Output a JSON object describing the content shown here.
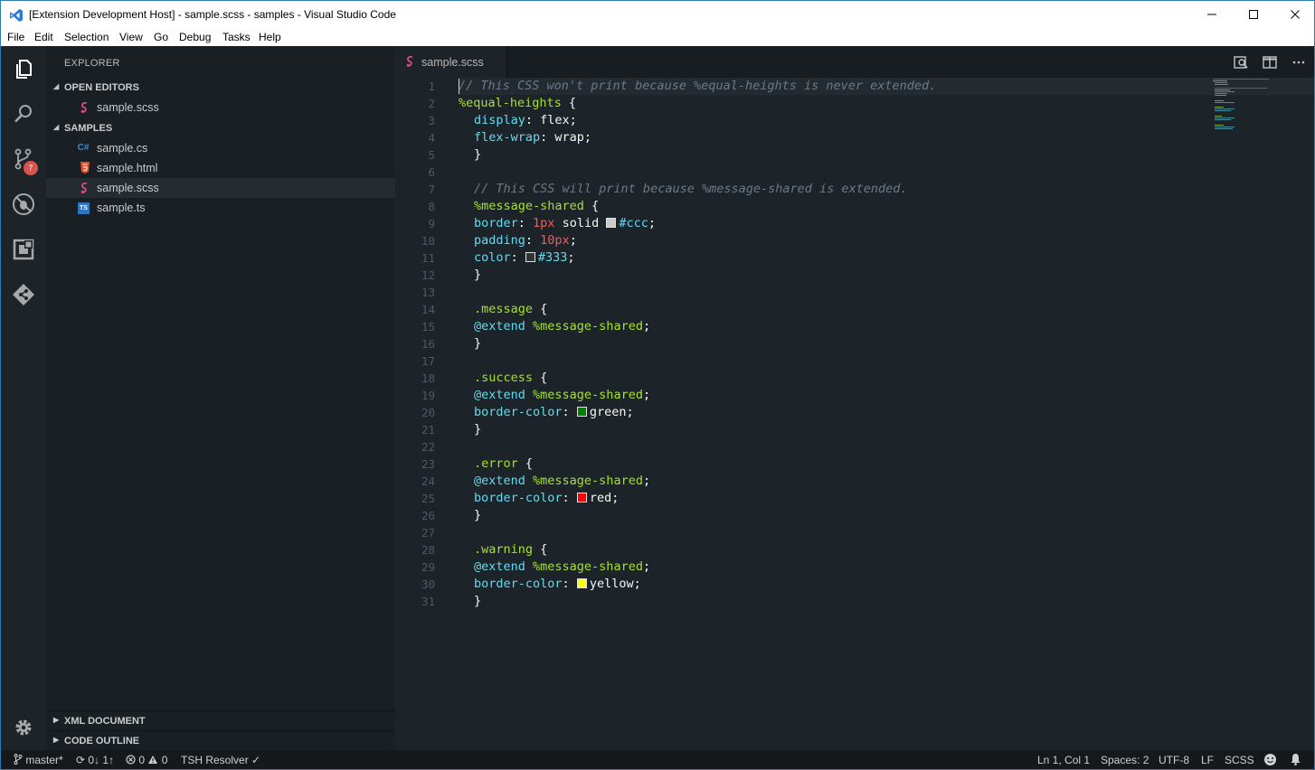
{
  "window": {
    "title": "[Extension Development Host] - sample.scss - samples - Visual Studio Code",
    "minimize_icon": "minimize-icon",
    "maximize_icon": "maximize-icon",
    "close_icon": "close-icon"
  },
  "menu": [
    "File",
    "Edit",
    "Selection",
    "View",
    "Go",
    "Debug",
    "Tasks",
    "Help"
  ],
  "activity": {
    "scm_badge": "7"
  },
  "explorer": {
    "title": "EXPLORER",
    "open_editors_label": "OPEN EDITORS",
    "open_editors": [
      {
        "name": "sample.scss",
        "icon": "sass-icon"
      }
    ],
    "samples_label": "SAMPLES",
    "files": [
      {
        "name": "sample.cs",
        "icon": "csharp-icon",
        "icon_text": "C#"
      },
      {
        "name": "sample.html",
        "icon": "html-icon",
        "icon_text": "5"
      },
      {
        "name": "sample.scss",
        "icon": "sass-icon",
        "icon_text": ""
      },
      {
        "name": "sample.ts",
        "icon": "typescript-icon",
        "icon_text": "TS"
      }
    ],
    "xml_document_label": "XML DOCUMENT",
    "code_outline_label": "CODE OUTLINE"
  },
  "editor": {
    "tab_label": "sample.scss",
    "line_numbers": [
      "1",
      "2",
      "3",
      "4",
      "5",
      "6",
      "7",
      "8",
      "9",
      "10",
      "11",
      "12",
      "13",
      "14",
      "15",
      "16",
      "17",
      "18",
      "19",
      "20",
      "21",
      "22",
      "23",
      "24",
      "25",
      "26",
      "27",
      "28",
      "29",
      "30",
      "31"
    ],
    "swatch_colors": {
      "ccc": "#cccccc",
      "333": "#333333",
      "green": "#008000",
      "red": "#ff0000",
      "yellow": "#ffff00"
    },
    "code": {
      "l1": "// This CSS won't print because %equal-heights is never extended.",
      "l2_sel": "%equal-heights",
      "l2_brace": " {",
      "l3_prop": "display",
      "l3_val": ": flex;",
      "l4_prop": "flex-wrap",
      "l4_val": ": wrap;",
      "l5": "}",
      "l7": "// This CSS will print because %message-shared is extended.",
      "l8_sel": "%message-shared",
      "l8_brace": " {",
      "l9_prop": "border",
      "l9_colon": ": ",
      "l9_num": "1px",
      "l9_solid": " solid ",
      "l9_hex": "#ccc",
      "l9_semi": ";",
      "l10_prop": "padding",
      "l10_colon": ": ",
      "l10_num": "10px",
      "l10_semi": ";",
      "l11_prop": "color",
      "l11_colon": ": ",
      "l11_hex": "#333",
      "l11_semi": ";",
      "l12": "}",
      "l14_sel": ".message",
      "l14_brace": " {",
      "l15_at": "@extend",
      "l15_ph": " %message-shared",
      "l15_semi": ";",
      "l16": "}",
      "l18_sel": ".success",
      "l18_brace": " {",
      "l19_at": "@extend",
      "l19_ph": " %message-shared",
      "l19_semi": ";",
      "l20_prop": "border-color",
      "l20_colon": ": ",
      "l20_val": "green;",
      "l21": "}",
      "l23_sel": ".error",
      "l23_brace": " {",
      "l24_at": "@extend",
      "l24_ph": " %message-shared",
      "l24_semi": ";",
      "l25_prop": "border-color",
      "l25_colon": ": ",
      "l25_val": "red;",
      "l26": "}",
      "l28_sel": ".warning",
      "l28_brace": " {",
      "l29_at": "@extend",
      "l29_ph": " %message-shared",
      "l29_semi": ";",
      "l30_prop": "border-color",
      "l30_colon": ": ",
      "l30_val": "yellow;",
      "l31": "}"
    }
  },
  "status": {
    "branch": "master*",
    "sync": "0↓ 1↑",
    "errors": "0",
    "warnings": "0",
    "resolver": "TSH Resolver ✓",
    "position": "Ln 1, Col 1",
    "spaces": "Spaces: 2",
    "encoding": "UTF-8",
    "eol": "LF",
    "language": "SCSS"
  }
}
